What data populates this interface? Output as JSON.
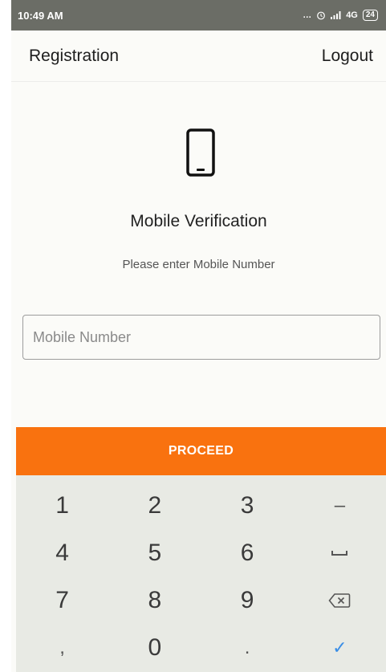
{
  "status_bar": {
    "time": "10:49 AM",
    "icons": [
      "dots-icon",
      "alarm-icon",
      "signal-icon"
    ],
    "network": "4G",
    "battery": "24"
  },
  "app_bar": {
    "title": "Registration",
    "logout_label": "Logout"
  },
  "verification": {
    "icon": "mobile-phone-icon",
    "title": "Mobile Verification",
    "subtitle": "Please enter Mobile Number"
  },
  "form": {
    "mobile_placeholder": "Mobile Number",
    "mobile_value": ""
  },
  "proceed_label": "PROCEED",
  "keypad": {
    "keys": [
      "1",
      "2",
      "3",
      "–",
      "4",
      "5",
      "6",
      "space",
      "7",
      "8",
      "9",
      "backspace",
      ",",
      "0",
      ".",
      "✓"
    ]
  },
  "colors": {
    "accent": "#f9720f",
    "status_bar": "#6b6d66",
    "keypad_bg": "#e8eae4",
    "enter_key": "#3a8ee6"
  }
}
